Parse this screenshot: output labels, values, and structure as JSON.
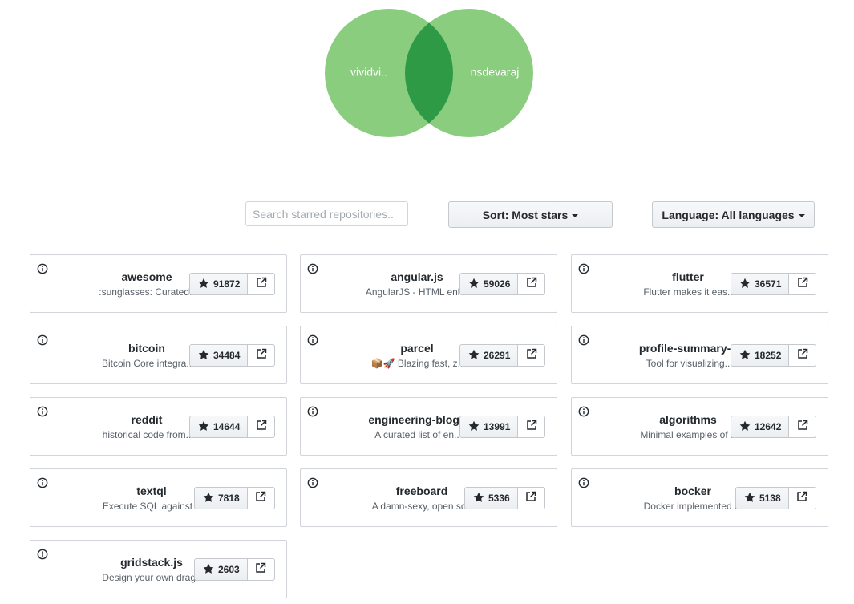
{
  "venn": {
    "left_label": "vividvi..",
    "right_label": "nsdevaraj",
    "circle_color": "#8bcd7f",
    "overlap_color": "#2e9a45"
  },
  "controls": {
    "search_placeholder": "Search starred repositories..",
    "sort_label": "Sort: Most stars",
    "language_label": "Language: All languages"
  },
  "repos": [
    {
      "name": "awesome",
      "description": ":sunglasses: Curated..",
      "stars": "91872"
    },
    {
      "name": "angular.js",
      "description": "AngularJS - HTML enh..",
      "stars": "59026"
    },
    {
      "name": "flutter",
      "description": "Flutter makes it eas..",
      "stars": "36571"
    },
    {
      "name": "bitcoin",
      "description": "Bitcoin Core integra..",
      "stars": "34484"
    },
    {
      "name": "parcel",
      "description": "📦🚀 Blazing fast, z..",
      "stars": "26291"
    },
    {
      "name": "profile-summary-..",
      "description": "Tool for visualizing..",
      "stars": "18252"
    },
    {
      "name": "reddit",
      "description": "historical code from..",
      "stars": "14644"
    },
    {
      "name": "engineering-blog..",
      "description": "A curated list of en..",
      "stars": "13991"
    },
    {
      "name": "algorithms",
      "description": "Minimal examples of ..",
      "stars": "12642"
    },
    {
      "name": "textql",
      "description": "Execute SQL against ..",
      "stars": "7818"
    },
    {
      "name": "freeboard",
      "description": "A damn-sexy, open so..",
      "stars": "5336"
    },
    {
      "name": "bocker",
      "description": "Docker implemented i..",
      "stars": "5138"
    },
    {
      "name": "gridstack.js",
      "description": "Design your own drag..",
      "stars": "2603"
    }
  ],
  "icons": {
    "info": "info-icon",
    "star": "star-icon",
    "external": "external-link-icon"
  }
}
